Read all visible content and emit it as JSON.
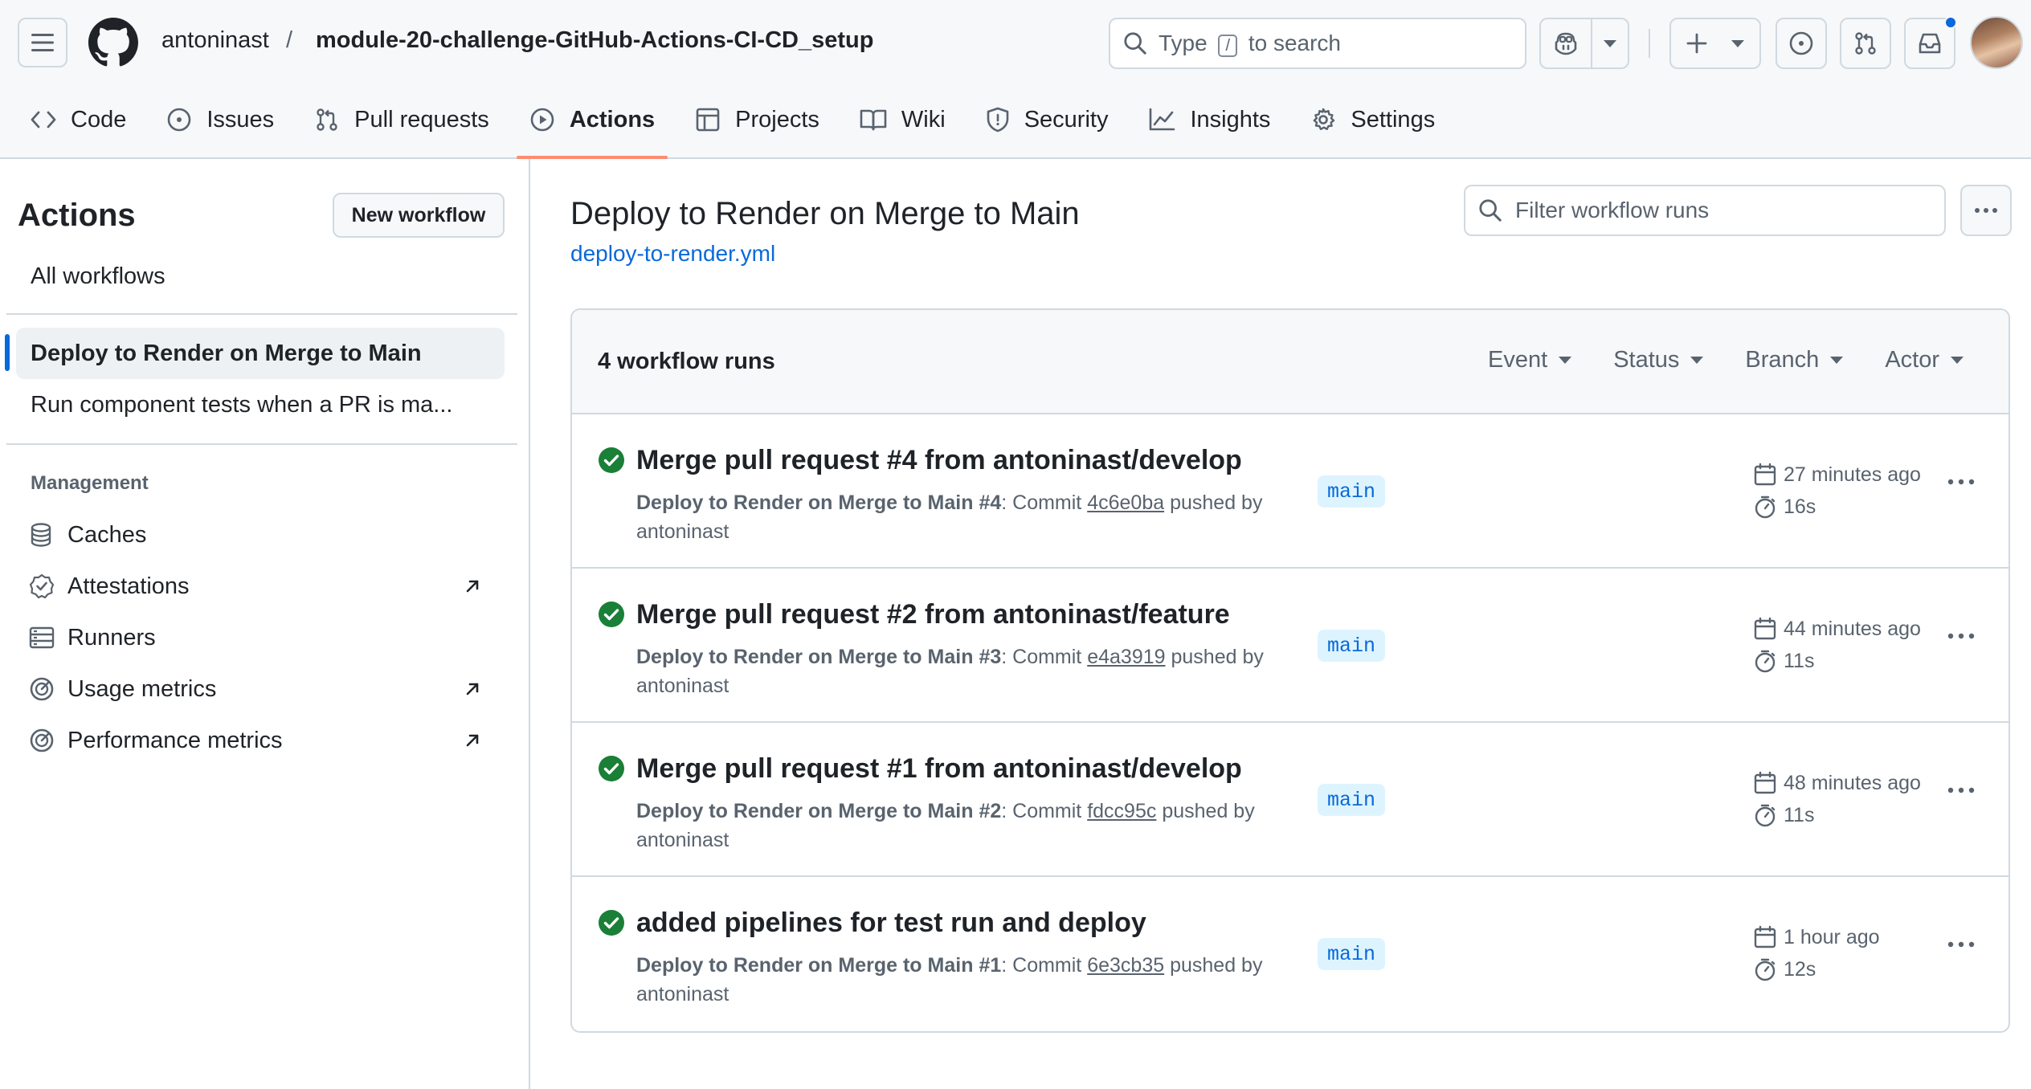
{
  "header": {
    "owner": "antoninast",
    "separator": "/",
    "repo": "module-20-challenge-GitHub-Actions-CI-CD_setup",
    "search_prefix": "Type",
    "search_key": "/",
    "search_suffix": "to search",
    "icons": [
      "hamburger-icon",
      "github-logo",
      "search-icon",
      "copilot-icon",
      "plus-icon",
      "issue-icon",
      "pull-request-icon",
      "inbox-icon",
      "avatar"
    ],
    "notification_color": "#0969da"
  },
  "nav": {
    "tabs": [
      {
        "label": "Code",
        "icon": "code-icon"
      },
      {
        "label": "Issues",
        "icon": "issue-icon"
      },
      {
        "label": "Pull requests",
        "icon": "pull-request-icon"
      },
      {
        "label": "Actions",
        "icon": "play-icon",
        "active": true
      },
      {
        "label": "Projects",
        "icon": "table-icon"
      },
      {
        "label": "Wiki",
        "icon": "book-icon"
      },
      {
        "label": "Security",
        "icon": "shield-icon"
      },
      {
        "label": "Insights",
        "icon": "graph-icon"
      },
      {
        "label": "Settings",
        "icon": "gear-icon"
      }
    ],
    "active_underline_color": "#fd8c73"
  },
  "sidebar": {
    "title": "Actions",
    "new_workflow": "New workflow",
    "all_workflows": "All workflows",
    "workflows": [
      "Deploy to Render on Merge to Main",
      "Run component tests when a PR is ma..."
    ],
    "management_label": "Management",
    "management": [
      {
        "label": "Caches",
        "icon": "database-icon",
        "external": false
      },
      {
        "label": "Attestations",
        "icon": "verified-icon",
        "external": true
      },
      {
        "label": "Runners",
        "icon": "server-icon",
        "external": false
      },
      {
        "label": "Usage metrics",
        "icon": "meter-icon",
        "external": true
      },
      {
        "label": "Performance metrics",
        "icon": "meter-icon",
        "external": true
      }
    ]
  },
  "main": {
    "title": "Deploy to Render on Merge to Main",
    "file": "deploy-to-render.yml",
    "filter_placeholder": "Filter workflow runs",
    "runs_count": "4 workflow runs",
    "filters": [
      "Event",
      "Status",
      "Branch",
      "Actor"
    ],
    "runs": [
      {
        "title": "Merge pull request #4 from antoninast/develop",
        "workflow": "Deploy to Render on Merge to Main",
        "run_no": "#4",
        "commit_label": ": Commit",
        "sha": "4c6e0ba",
        "pushed_by": "pushed by",
        "actor": "antoninast",
        "branch": "main",
        "when": "27 minutes ago",
        "duration": "16s"
      },
      {
        "title": "Merge pull request #2 from antoninast/feature",
        "workflow": "Deploy to Render on Merge to Main",
        "run_no": "#3",
        "commit_label": ": Commit",
        "sha": "e4a3919",
        "pushed_by": "pushed by",
        "actor": "antoninast",
        "branch": "main",
        "when": "44 minutes ago",
        "duration": "11s"
      },
      {
        "title": "Merge pull request #1 from antoninast/develop",
        "workflow": "Deploy to Render on Merge to Main",
        "run_no": "#2",
        "commit_label": ": Commit",
        "sha": "fdcc95c",
        "pushed_by": "pushed by",
        "actor": "antoninast",
        "branch": "main",
        "when": "48 minutes ago",
        "duration": "11s"
      },
      {
        "title": "added pipelines for test run and deploy",
        "workflow": "Deploy to Render on Merge to Main",
        "run_no": "#1",
        "commit_label": ": Commit",
        "sha": "6e3cb35",
        "pushed_by": "pushed by",
        "actor": "antoninast",
        "branch": "main",
        "when": "1 hour ago",
        "duration": "12s"
      }
    ],
    "status_color": "#1a7f37"
  }
}
